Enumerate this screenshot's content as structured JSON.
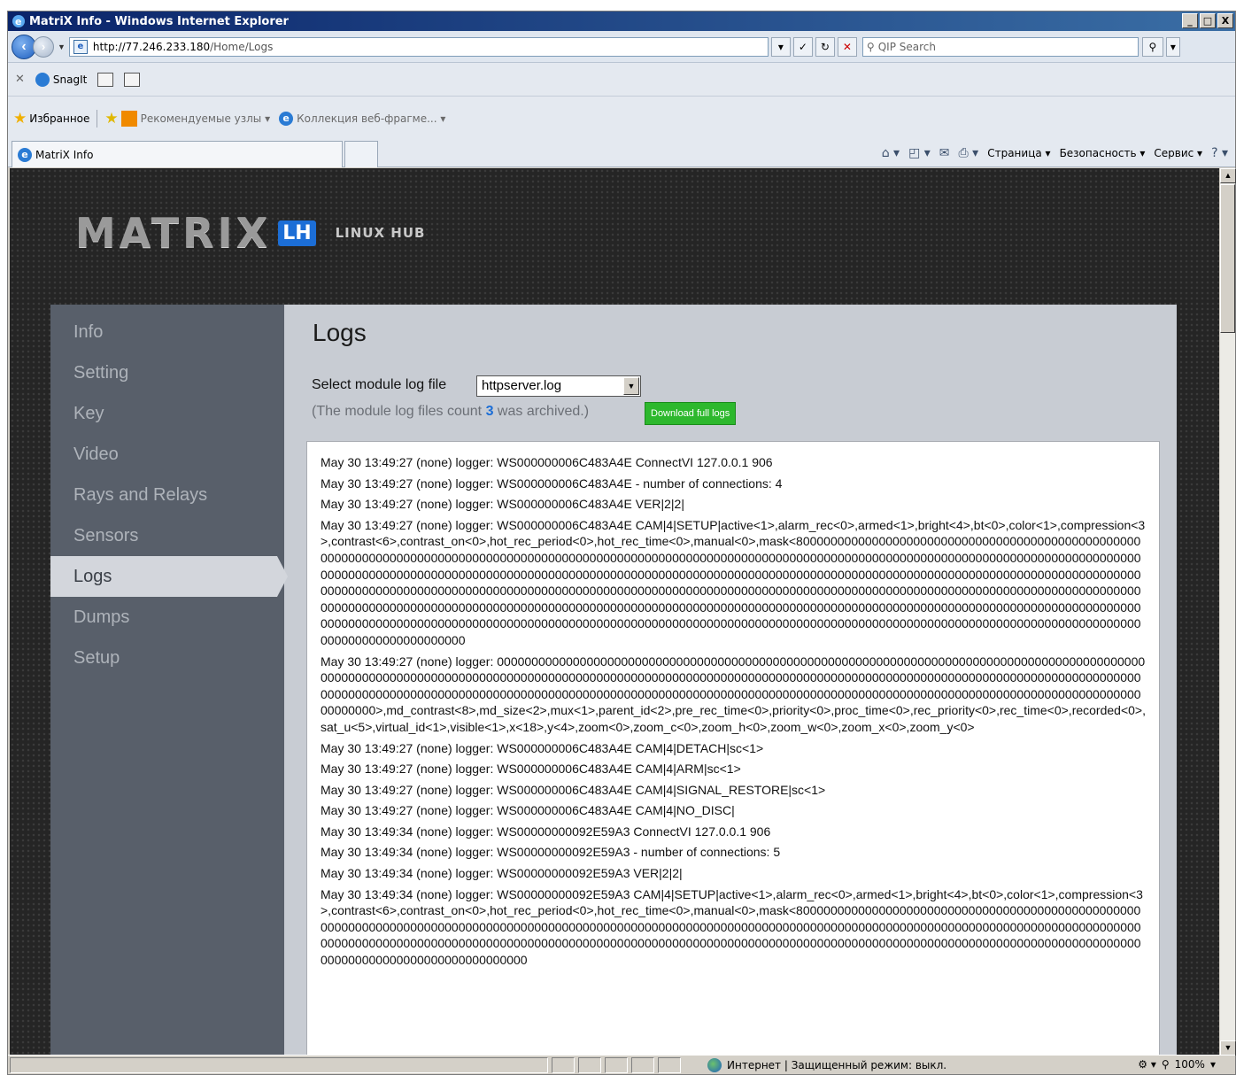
{
  "window": {
    "title": "MatriX Info - Windows Internet Explorer",
    "min": "_",
    "max": "□",
    "close": "X"
  },
  "address": {
    "url_host": "http://77.246.233.180",
    "url_path": "/Home/Logs",
    "search_placeholder": "QIP Search"
  },
  "toolbar": {
    "snagit": "SnagIt"
  },
  "favorites": {
    "label": "Избранное",
    "recommended": "Рекомендуемые узлы ▾",
    "collection": "Коллекция веб-фрагме... ▾"
  },
  "tab": {
    "title": "MatriX Info"
  },
  "commandbar": {
    "page": "Страница ▾",
    "security": "Безопасность ▾",
    "tools": "Сервис ▾"
  },
  "site": {
    "logo": "MATRIX",
    "badge": "LH",
    "subtitle": "LINUX HUB"
  },
  "sidebar": {
    "items": [
      {
        "label": "Info"
      },
      {
        "label": "Setting"
      },
      {
        "label": "Key"
      },
      {
        "label": "Video"
      },
      {
        "label": "Rays and Relays"
      },
      {
        "label": "Sensors"
      },
      {
        "label": "Logs",
        "active": true
      },
      {
        "label": "Dumps"
      },
      {
        "label": "Setup"
      }
    ]
  },
  "main": {
    "title": "Logs",
    "select_label": "Select module log file",
    "selected_file": "httpserver.log",
    "archived_prefix": "(The module log files count",
    "archived_count": "3",
    "archived_suffix": "was archived.)",
    "download_label": "Download full logs"
  },
  "logs": [
    "May 30 13:49:27 (none) logger: WS000000006C483A4E ConnectVI 127.0.0.1 906",
    "May 30 13:49:27 (none) logger: WS000000006C483A4E - number of connections: 4",
    "May 30 13:49:27 (none) logger: WS000000006C483A4E VER|2|2|",
    "May 30 13:49:27 (none) logger: WS000000006C483A4E CAM|4|SETUP|active<1>,alarm_rec<0>,armed<1>,bright<4>,bt<0>,color<1>,compression<3>,contrast<6>,contrast_on<0>,hot_rec_period<0>,hot_rec_time<0>,manual<0>,mask<800000000000000000000000000000000000000000000000000000000000000000000000000000000000000000000000000000000000000000000000000000000000000000000000000000000000000000000000000000000000000000000000000000000000000000000000000000000000000000000000000000000000000000000000000000000000000000000000000000000000000000000000000000000000000000000000000000000000000000000000000000000000000000000000000000000000000000000000000000000000000000000000000000000000000000000000000000000000000000000000000000000000000000000000000000000000000000000000000000000000000000000000000000000000000000000000000000000000000000000000000000000000000000000000000000000000000000000000000000000000000000",
    "May 30 13:49:27 (none) logger: 0000000000000000000000000000000000000000000000000000000000000000000000000000000000000000000000000000000000000000000000000000000000000000000000000000000000000000000000000000000000000000000000000000000000000000000000000000000000000000000000000000000000000000000000000000000000000000000000000000000000000000000000000000000000000000000000000000>,md_contrast<8>,md_size<2>,mux<1>,parent_id<2>,pre_rec_time<0>,priority<0>,proc_time<0>,rec_priority<0>,rec_time<0>,recorded<0>,sat_u<5>,virtual_id<1>,visible<1>,x<18>,y<4>,zoom<0>,zoom_c<0>,zoom_h<0>,zoom_w<0>,zoom_x<0>,zoom_y<0>",
    "May 30 13:49:27 (none) logger: WS000000006C483A4E CAM|4|DETACH|sc<1>",
    "May 30 13:49:27 (none) logger: WS000000006C483A4E CAM|4|ARM|sc<1>",
    "May 30 13:49:27 (none) logger: WS000000006C483A4E CAM|4|SIGNAL_RESTORE|sc<1>",
    "May 30 13:49:27 (none) logger: WS000000006C483A4E CAM|4|NO_DISC|",
    "May 30 13:49:34 (none) logger: WS00000000092E59A3 ConnectVI 127.0.0.1 906",
    "May 30 13:49:34 (none) logger: WS00000000092E59A3 - number of connections: 5",
    "May 30 13:49:34 (none) logger: WS00000000092E59A3 VER|2|2|",
    "May 30 13:49:34 (none) logger: WS00000000092E59A3 CAM|4|SETUP|active<1>,alarm_rec<0>,armed<1>,bright<4>,bt<0>,color<1>,compression<3>,contrast<6>,contrast_on<0>,hot_rec_period<0>,hot_rec_time<0>,manual<0>,mask<800000000000000000000000000000000000000000000000000000000000000000000000000000000000000000000000000000000000000000000000000000000000000000000000000000000000000000000000000000000000000000000000000000000000000000000000000000000000000000000000000000000000000000000000000000000000000000000000000000000000000000000000000000"
  ],
  "status": {
    "zone": "Интернет | Защищенный режим: выкл.",
    "zoom": "100%"
  }
}
